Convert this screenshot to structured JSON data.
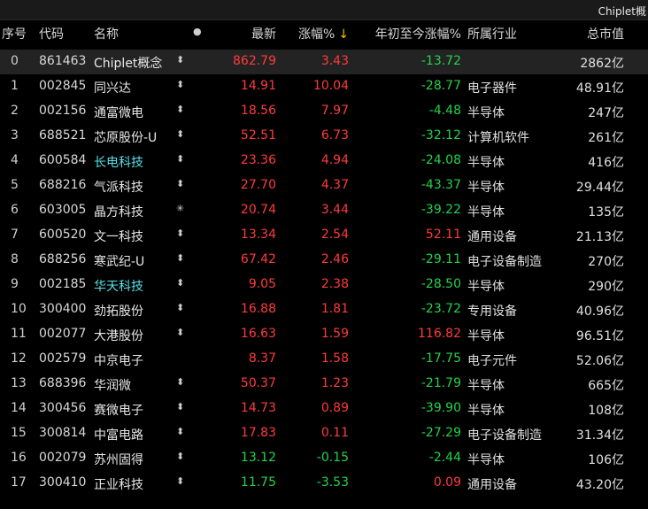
{
  "window": {
    "title": "Chiplet概"
  },
  "colors": {
    "up": "#ff3b3b",
    "down": "#22d34a",
    "cyan": "#55e0e8",
    "arrow": "#f0c000"
  },
  "header": {
    "seq": "序号",
    "code": "代码",
    "name": "名称",
    "dot": "●",
    "price": "最新",
    "change": "涨幅%",
    "arrow": "↓",
    "ytd": "年初至今涨幅%",
    "industry": "所属行业",
    "cap": "总市值"
  },
  "rows": [
    {
      "seq": "0",
      "code": "861463",
      "name": "Chiplet概念",
      "mark": "⬍",
      "price": "862.79",
      "change": "3.43",
      "ytd": "-13.72",
      "industry": "",
      "cap": "2862亿",
      "dir": "up",
      "ytd_dir": "down",
      "name_style": ""
    },
    {
      "seq": "1",
      "code": "002845",
      "name": "同兴达",
      "mark": "⬍",
      "price": "14.91",
      "change": "10.04",
      "ytd": "-28.77",
      "industry": "电子器件",
      "cap": "48.91亿",
      "dir": "up",
      "ytd_dir": "down",
      "name_style": ""
    },
    {
      "seq": "2",
      "code": "002156",
      "name": "通富微电",
      "mark": "⬍",
      "price": "18.56",
      "change": "7.97",
      "ytd": "-4.48",
      "industry": "半导体",
      "cap": "247亿",
      "dir": "up",
      "ytd_dir": "down",
      "name_style": ""
    },
    {
      "seq": "3",
      "code": "688521",
      "name": "芯原股份-U",
      "mark": "⬍",
      "price": "52.51",
      "change": "6.73",
      "ytd": "-32.12",
      "industry": "计算机软件",
      "cap": "261亿",
      "dir": "up",
      "ytd_dir": "down",
      "name_style": ""
    },
    {
      "seq": "4",
      "code": "600584",
      "name": "长电科技",
      "mark": "⬍",
      "price": "23.36",
      "change": "4.94",
      "ytd": "-24.08",
      "industry": "半导体",
      "cap": "416亿",
      "dir": "up",
      "ytd_dir": "down",
      "name_style": "cyan"
    },
    {
      "seq": "5",
      "code": "688216",
      "name": "气派科技",
      "mark": "⬍",
      "price": "27.70",
      "change": "4.37",
      "ytd": "-43.37",
      "industry": "半导体",
      "cap": "29.44亿",
      "dir": "up",
      "ytd_dir": "down",
      "name_style": ""
    },
    {
      "seq": "6",
      "code": "603005",
      "name": "晶方科技",
      "mark": "✳",
      "price": "20.74",
      "change": "3.44",
      "ytd": "-39.22",
      "industry": "半导体",
      "cap": "135亿",
      "dir": "up",
      "ytd_dir": "down",
      "name_style": ""
    },
    {
      "seq": "7",
      "code": "600520",
      "name": "文一科技",
      "mark": "⬍",
      "price": "13.34",
      "change": "2.54",
      "ytd": "52.11",
      "industry": "通用设备",
      "cap": "21.13亿",
      "dir": "up",
      "ytd_dir": "up",
      "name_style": ""
    },
    {
      "seq": "8",
      "code": "688256",
      "name": "寒武纪-U",
      "mark": "⬍",
      "price": "67.42",
      "change": "2.46",
      "ytd": "-29.11",
      "industry": "电子设备制造",
      "cap": "270亿",
      "dir": "up",
      "ytd_dir": "down",
      "name_style": ""
    },
    {
      "seq": "9",
      "code": "002185",
      "name": "华天科技",
      "mark": "⬍",
      "price": "9.05",
      "change": "2.38",
      "ytd": "-28.50",
      "industry": "半导体",
      "cap": "290亿",
      "dir": "up",
      "ytd_dir": "down",
      "name_style": "cyan"
    },
    {
      "seq": "10",
      "code": "300400",
      "name": "劲拓股份",
      "mark": "⬍",
      "price": "16.88",
      "change": "1.81",
      "ytd": "-23.72",
      "industry": "专用设备",
      "cap": "40.96亿",
      "dir": "up",
      "ytd_dir": "down",
      "name_style": ""
    },
    {
      "seq": "11",
      "code": "002077",
      "name": "大港股份",
      "mark": "⬍",
      "price": "16.63",
      "change": "1.59",
      "ytd": "116.82",
      "industry": "半导体",
      "cap": "96.51亿",
      "dir": "up",
      "ytd_dir": "up",
      "name_style": ""
    },
    {
      "seq": "12",
      "code": "002579",
      "name": "中京电子",
      "mark": "",
      "price": "8.37",
      "change": "1.58",
      "ytd": "-17.75",
      "industry": "电子元件",
      "cap": "52.06亿",
      "dir": "up",
      "ytd_dir": "down",
      "name_style": ""
    },
    {
      "seq": "13",
      "code": "688396",
      "name": "华润微",
      "mark": "⬍",
      "price": "50.37",
      "change": "1.23",
      "ytd": "-21.79",
      "industry": "半导体",
      "cap": "665亿",
      "dir": "up",
      "ytd_dir": "down",
      "name_style": ""
    },
    {
      "seq": "14",
      "code": "300456",
      "name": "赛微电子",
      "mark": "⬍",
      "price": "14.73",
      "change": "0.89",
      "ytd": "-39.90",
      "industry": "半导体",
      "cap": "108亿",
      "dir": "up",
      "ytd_dir": "down",
      "name_style": ""
    },
    {
      "seq": "15",
      "code": "300814",
      "name": "中富电路",
      "mark": "⬍",
      "price": "17.83",
      "change": "0.11",
      "ytd": "-27.29",
      "industry": "电子设备制造",
      "cap": "31.34亿",
      "dir": "up",
      "ytd_dir": "down",
      "name_style": ""
    },
    {
      "seq": "16",
      "code": "002079",
      "name": "苏州固得",
      "mark": "⬍",
      "price": "13.12",
      "change": "-0.15",
      "ytd": "-2.44",
      "industry": "半导体",
      "cap": "106亿",
      "dir": "down",
      "ytd_dir": "down",
      "name_style": ""
    },
    {
      "seq": "17",
      "code": "300410",
      "name": "正业科技",
      "mark": "⬍",
      "price": "11.75",
      "change": "-3.53",
      "ytd": "0.09",
      "industry": "通用设备",
      "cap": "43.20亿",
      "dir": "down",
      "ytd_dir": "up",
      "name_style": ""
    }
  ]
}
